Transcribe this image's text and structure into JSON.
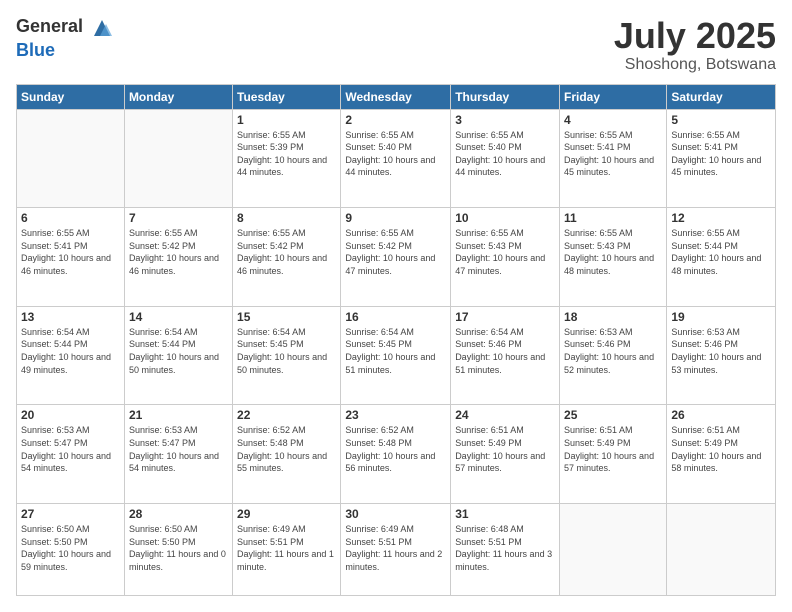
{
  "logo": {
    "general": "General",
    "blue": "Blue"
  },
  "title": "July 2025",
  "location": "Shoshong, Botswana",
  "headers": [
    "Sunday",
    "Monday",
    "Tuesday",
    "Wednesday",
    "Thursday",
    "Friday",
    "Saturday"
  ],
  "weeks": [
    [
      {
        "day": "",
        "info": ""
      },
      {
        "day": "",
        "info": ""
      },
      {
        "day": "1",
        "info": "Sunrise: 6:55 AM\nSunset: 5:39 PM\nDaylight: 10 hours and 44 minutes."
      },
      {
        "day": "2",
        "info": "Sunrise: 6:55 AM\nSunset: 5:40 PM\nDaylight: 10 hours and 44 minutes."
      },
      {
        "day": "3",
        "info": "Sunrise: 6:55 AM\nSunset: 5:40 PM\nDaylight: 10 hours and 44 minutes."
      },
      {
        "day": "4",
        "info": "Sunrise: 6:55 AM\nSunset: 5:41 PM\nDaylight: 10 hours and 45 minutes."
      },
      {
        "day": "5",
        "info": "Sunrise: 6:55 AM\nSunset: 5:41 PM\nDaylight: 10 hours and 45 minutes."
      }
    ],
    [
      {
        "day": "6",
        "info": "Sunrise: 6:55 AM\nSunset: 5:41 PM\nDaylight: 10 hours and 46 minutes."
      },
      {
        "day": "7",
        "info": "Sunrise: 6:55 AM\nSunset: 5:42 PM\nDaylight: 10 hours and 46 minutes."
      },
      {
        "day": "8",
        "info": "Sunrise: 6:55 AM\nSunset: 5:42 PM\nDaylight: 10 hours and 46 minutes."
      },
      {
        "day": "9",
        "info": "Sunrise: 6:55 AM\nSunset: 5:42 PM\nDaylight: 10 hours and 47 minutes."
      },
      {
        "day": "10",
        "info": "Sunrise: 6:55 AM\nSunset: 5:43 PM\nDaylight: 10 hours and 47 minutes."
      },
      {
        "day": "11",
        "info": "Sunrise: 6:55 AM\nSunset: 5:43 PM\nDaylight: 10 hours and 48 minutes."
      },
      {
        "day": "12",
        "info": "Sunrise: 6:55 AM\nSunset: 5:44 PM\nDaylight: 10 hours and 48 minutes."
      }
    ],
    [
      {
        "day": "13",
        "info": "Sunrise: 6:54 AM\nSunset: 5:44 PM\nDaylight: 10 hours and 49 minutes."
      },
      {
        "day": "14",
        "info": "Sunrise: 6:54 AM\nSunset: 5:44 PM\nDaylight: 10 hours and 50 minutes."
      },
      {
        "day": "15",
        "info": "Sunrise: 6:54 AM\nSunset: 5:45 PM\nDaylight: 10 hours and 50 minutes."
      },
      {
        "day": "16",
        "info": "Sunrise: 6:54 AM\nSunset: 5:45 PM\nDaylight: 10 hours and 51 minutes."
      },
      {
        "day": "17",
        "info": "Sunrise: 6:54 AM\nSunset: 5:46 PM\nDaylight: 10 hours and 51 minutes."
      },
      {
        "day": "18",
        "info": "Sunrise: 6:53 AM\nSunset: 5:46 PM\nDaylight: 10 hours and 52 minutes."
      },
      {
        "day": "19",
        "info": "Sunrise: 6:53 AM\nSunset: 5:46 PM\nDaylight: 10 hours and 53 minutes."
      }
    ],
    [
      {
        "day": "20",
        "info": "Sunrise: 6:53 AM\nSunset: 5:47 PM\nDaylight: 10 hours and 54 minutes."
      },
      {
        "day": "21",
        "info": "Sunrise: 6:53 AM\nSunset: 5:47 PM\nDaylight: 10 hours and 54 minutes."
      },
      {
        "day": "22",
        "info": "Sunrise: 6:52 AM\nSunset: 5:48 PM\nDaylight: 10 hours and 55 minutes."
      },
      {
        "day": "23",
        "info": "Sunrise: 6:52 AM\nSunset: 5:48 PM\nDaylight: 10 hours and 56 minutes."
      },
      {
        "day": "24",
        "info": "Sunrise: 6:51 AM\nSunset: 5:49 PM\nDaylight: 10 hours and 57 minutes."
      },
      {
        "day": "25",
        "info": "Sunrise: 6:51 AM\nSunset: 5:49 PM\nDaylight: 10 hours and 57 minutes."
      },
      {
        "day": "26",
        "info": "Sunrise: 6:51 AM\nSunset: 5:49 PM\nDaylight: 10 hours and 58 minutes."
      }
    ],
    [
      {
        "day": "27",
        "info": "Sunrise: 6:50 AM\nSunset: 5:50 PM\nDaylight: 10 hours and 59 minutes."
      },
      {
        "day": "28",
        "info": "Sunrise: 6:50 AM\nSunset: 5:50 PM\nDaylight: 11 hours and 0 minutes."
      },
      {
        "day": "29",
        "info": "Sunrise: 6:49 AM\nSunset: 5:51 PM\nDaylight: 11 hours and 1 minute."
      },
      {
        "day": "30",
        "info": "Sunrise: 6:49 AM\nSunset: 5:51 PM\nDaylight: 11 hours and 2 minutes."
      },
      {
        "day": "31",
        "info": "Sunrise: 6:48 AM\nSunset: 5:51 PM\nDaylight: 11 hours and 3 minutes."
      },
      {
        "day": "",
        "info": ""
      },
      {
        "day": "",
        "info": ""
      }
    ]
  ]
}
